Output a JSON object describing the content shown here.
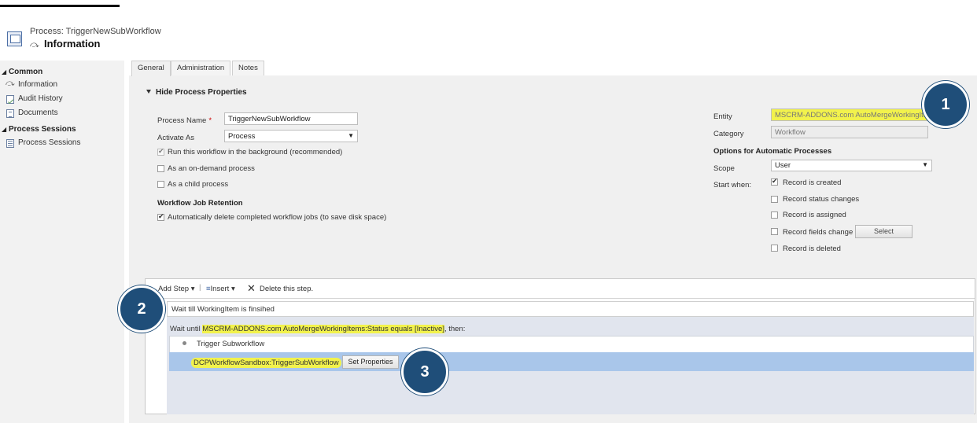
{
  "header": {
    "subtitle": "Process: TriggerNewSubWorkflow",
    "title": "Information"
  },
  "nav": {
    "groups": [
      {
        "label": "Common",
        "items": [
          "Information",
          "Audit History",
          "Documents"
        ]
      },
      {
        "label": "Process Sessions",
        "items": [
          "Process Sessions"
        ]
      }
    ]
  },
  "tabs": [
    "General",
    "Administration",
    "Notes"
  ],
  "properties": {
    "section_title": "Hide Process Properties",
    "process_name_label": "Process Name",
    "process_name_value": "TriggerNewSubWorkflow",
    "activate_as_label": "Activate As",
    "activate_as_value": "Process",
    "run_background": "Run this workflow in the background (recommended)",
    "on_demand": "As an on-demand process",
    "child_process": "As a child process",
    "retention_title": "Workflow Job Retention",
    "auto_delete": "Automatically delete completed workflow jobs (to save disk space)",
    "entity_label": "Entity",
    "entity_value": "MSCRM-ADDONS.com AutoMergeWorkingItem",
    "category_label": "Category",
    "category_value": "Workflow",
    "options_title": "Options for Automatic Processes",
    "scope_label": "Scope",
    "scope_value": "User",
    "start_when_label": "Start when:",
    "start_options": [
      "Record is created",
      "Record status changes",
      "Record is assigned",
      "Record fields change",
      "Record is deleted"
    ],
    "select_button": "Select"
  },
  "designer": {
    "add_step": "Add Step",
    "insert": "Insert",
    "delete_step": "Delete this step.",
    "step_description": "Wait till WorkingItem is finsihed",
    "wait_prefix": "Wait until ",
    "wait_condition": "MSCRM-ADDONS.com AutoMergeWorkingItems:Status equals [Inactive]",
    "wait_suffix": ", then:",
    "child_step_name": "Trigger Subworkflow",
    "child_workflow": "DCPWorkflowSandbox:TriggerSubWorkflow",
    "set_properties": "Set Properties"
  },
  "callouts": [
    "1",
    "2",
    "3"
  ],
  "colors": {
    "callout": "#1f4e79",
    "highlight": "#f2f24c",
    "selected_row": "#a9c6ea"
  },
  "icons": [
    "process-icon",
    "workflow-icon",
    "audit-history-icon",
    "document-icon",
    "process-sessions-icon",
    "close-x-icon"
  ]
}
